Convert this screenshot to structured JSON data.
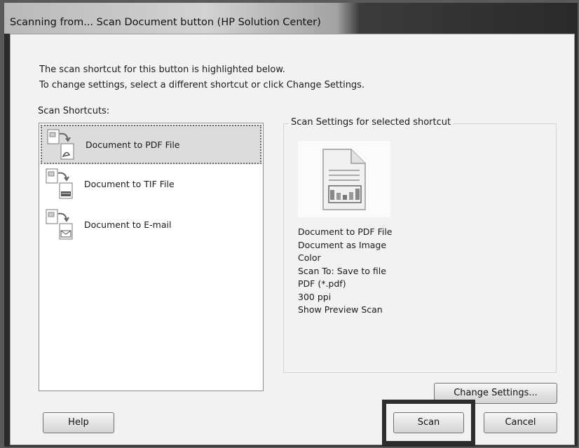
{
  "window": {
    "title": "Scanning from... Scan Document button (HP Solution Center)"
  },
  "intro": {
    "line1": "The scan shortcut for this button is highlighted below.",
    "line2": "To change settings, select a different shortcut or click Change Settings."
  },
  "shortcuts": {
    "label": "Scan Shortcuts:",
    "items": [
      {
        "label": "Document to PDF File",
        "icon": "pdf-document-icon",
        "selected": true
      },
      {
        "label": "Document to TIF File",
        "icon": "tif-document-icon",
        "selected": false
      },
      {
        "label": "Document to E-mail",
        "icon": "email-document-icon",
        "selected": false
      }
    ]
  },
  "settings": {
    "group_label": "Scan Settings for selected shortcut",
    "preview_icon": "document-preview-icon",
    "details": [
      "Document to PDF File",
      "Document as Image",
      "Color",
      "Scan To: Save to file",
      "PDF (*.pdf)",
      "300 ppi",
      "Show Preview Scan"
    ]
  },
  "buttons": {
    "change_settings": "Change Settings...",
    "help": "Help",
    "scan": "Scan",
    "cancel": "Cancel"
  }
}
